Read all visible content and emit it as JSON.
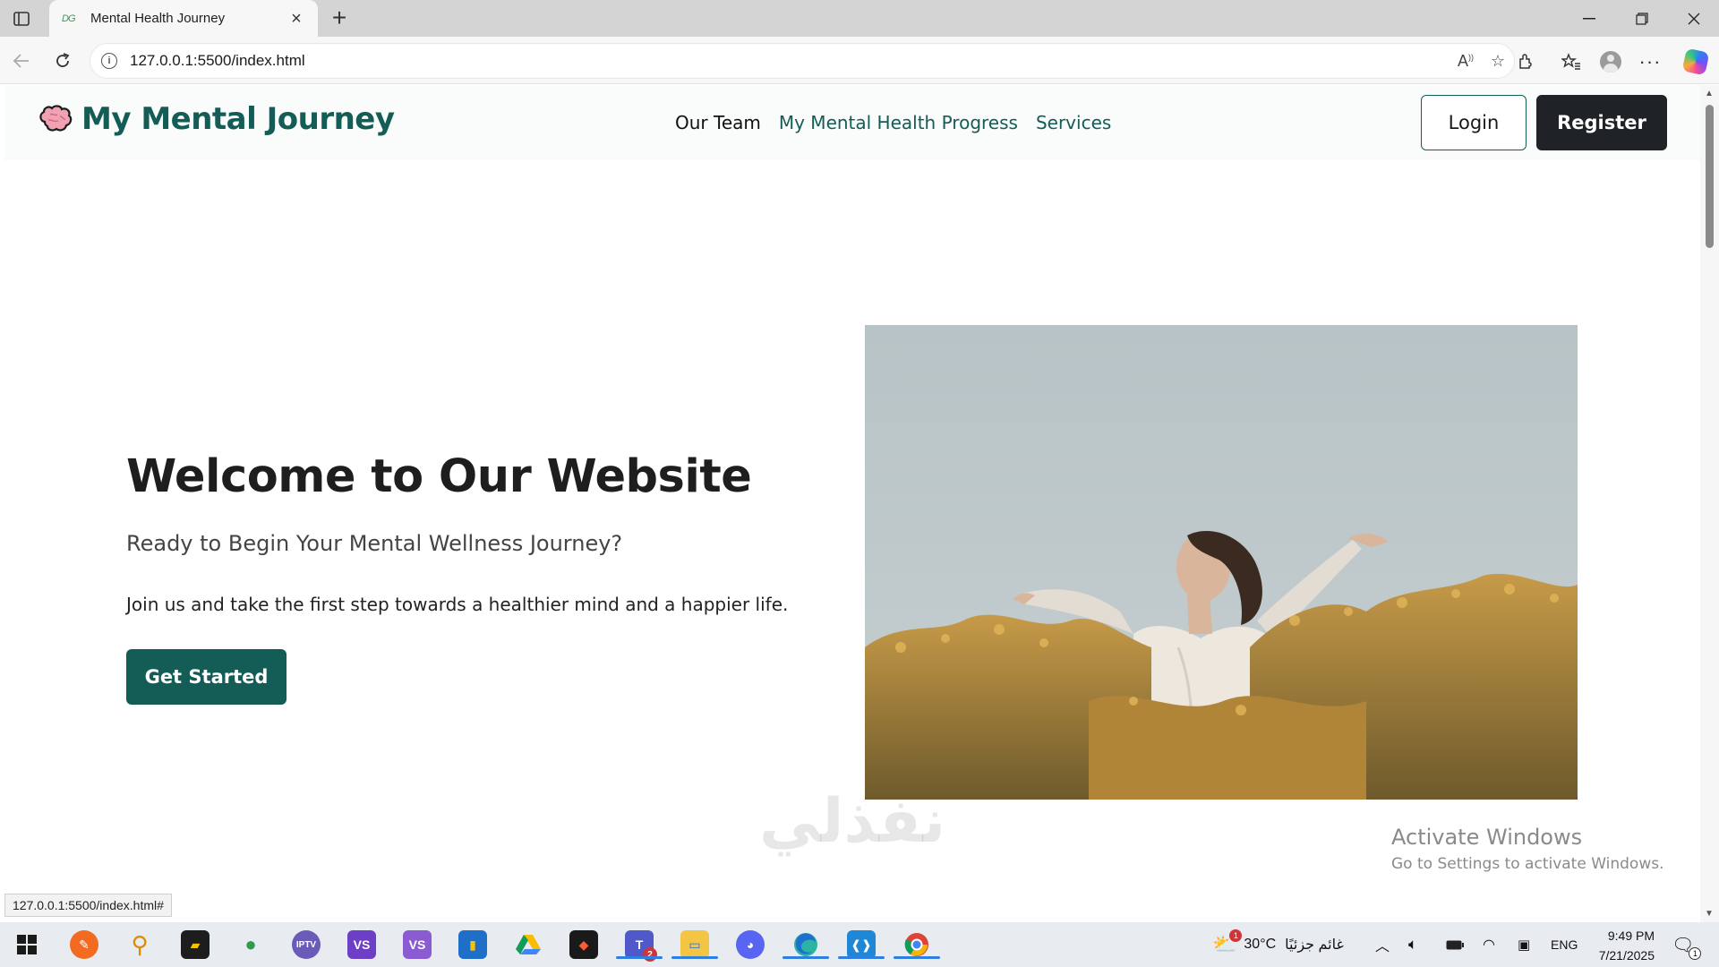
{
  "browser": {
    "tab_title": "Mental Health Journey",
    "tab_favicon": "DG",
    "url": "127.0.0.1:5500/index.html",
    "status_link": "127.0.0.1:5500/index.html#"
  },
  "site": {
    "logo_text": "My Mental Journey",
    "nav": [
      "Our Team",
      "My Mental Health Progress",
      "Services"
    ],
    "login_label": "Login",
    "register_label": "Register"
  },
  "hero": {
    "title": "Welcome to Our Website",
    "subtitle": "Ready to Begin Your Mental Wellness Journey?",
    "description": "Join us and take the first step towards a healthier mind and a happier life.",
    "cta_label": "Get Started",
    "image": "woman-arms-outstretched-in-yellow-flower-field"
  },
  "overlay": {
    "activate_title": "Activate Windows",
    "activate_sub": "Go to Settings to activate Windows.",
    "watermark": "نفذلي"
  },
  "taskbar": {
    "weather": "30°C",
    "weather_desc": "غائم جزئيًا",
    "weather_badge": "1",
    "lang": "ENG",
    "time": "9:49 PM",
    "date": "7/21/2025",
    "teams_badge": "2",
    "notif_badge": "1"
  },
  "colors": {
    "brand": "#145c56",
    "dark_button": "#1f2327"
  }
}
